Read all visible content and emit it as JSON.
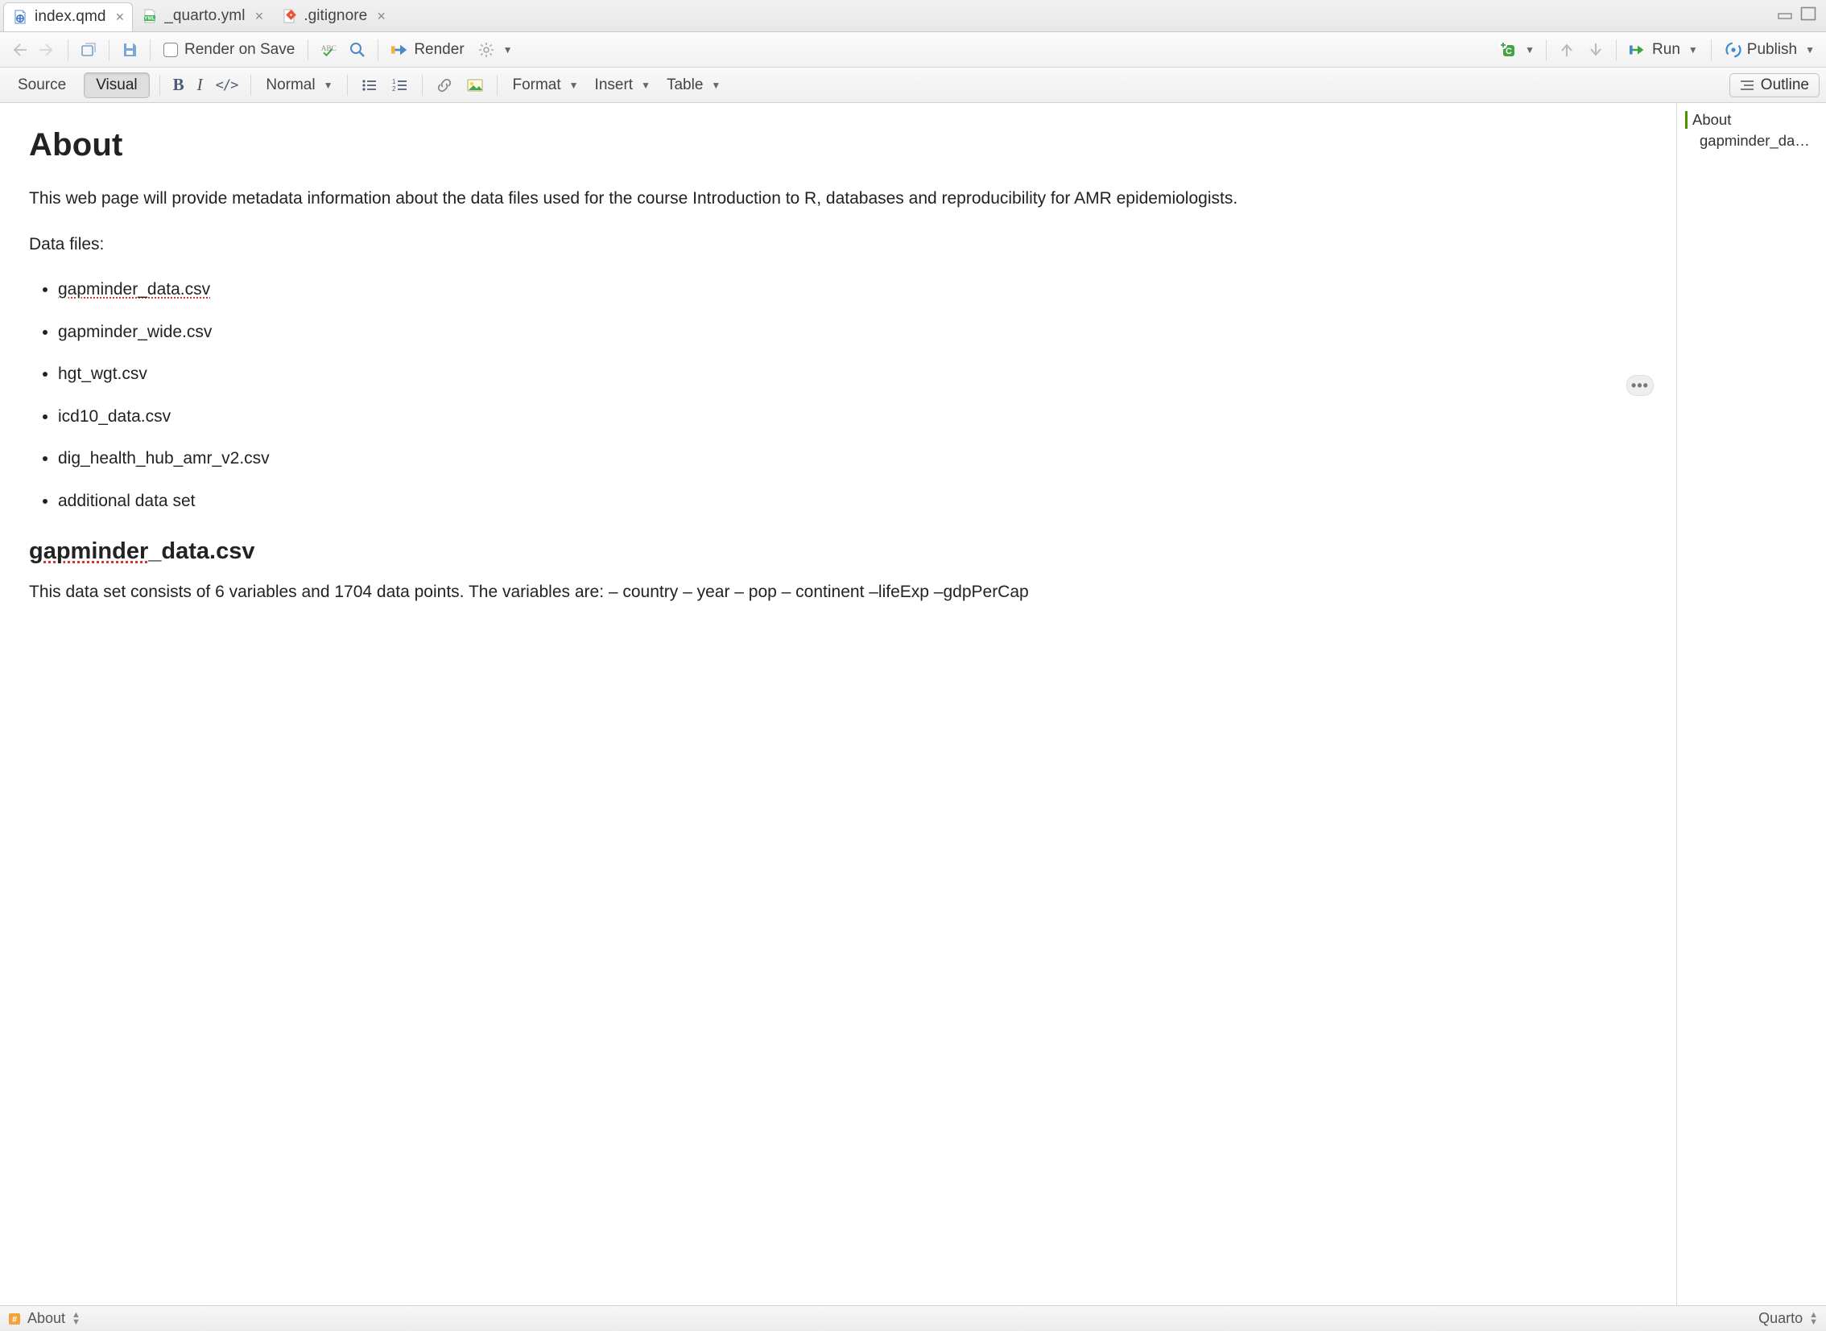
{
  "tabs": [
    {
      "label": "index.qmd",
      "active": true
    },
    {
      "label": "_quarto.yml",
      "active": false
    },
    {
      "label": ".gitignore",
      "active": false
    }
  ],
  "toolbar": {
    "render_on_save": "Render on Save",
    "render": "Render",
    "run": "Run",
    "publish": "Publish"
  },
  "formatbar": {
    "source": "Source",
    "visual": "Visual",
    "normal": "Normal",
    "format": "Format",
    "insert": "Insert",
    "table": "Table",
    "outline": "Outline"
  },
  "document": {
    "h1": "About",
    "p1": "This web page will provide metadata information about the data files used for the course Introduction to R, databases and reproducibility for AMR epidemiologists.",
    "files_label": "Data files:",
    "files": [
      "gapminder_data.csv",
      "gapminder_wide.csv",
      "hgt_wgt.csv",
      "icd10_data.csv",
      "dig_health_hub_amr_v2.csv",
      "additional data set"
    ],
    "h2_spell_a": "gapminder",
    "h2_spell_b": "_data.csv",
    "p2": "This data set consists of 6 variables and 1704 data points. The variables are: – country – year – pop – continent –lifeExp –gdpPerCap"
  },
  "outline_pane": {
    "i0": "About",
    "i1": "gapminder_da…"
  },
  "statusbar": {
    "left": "About",
    "right": "Quarto"
  }
}
